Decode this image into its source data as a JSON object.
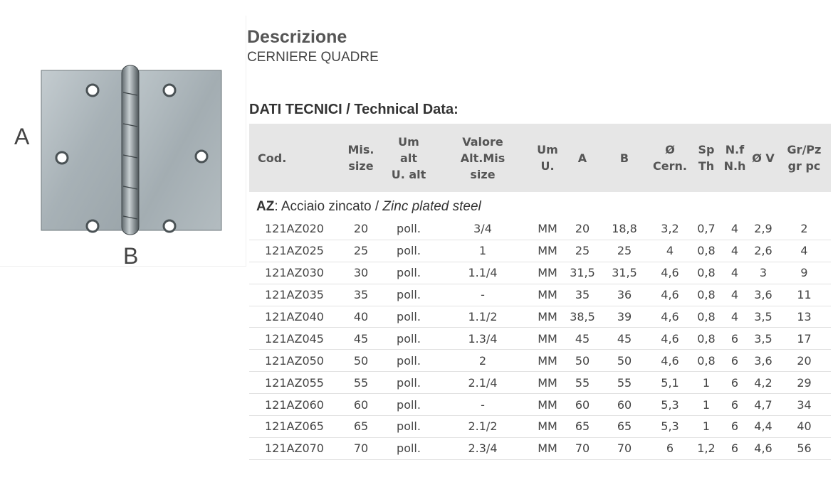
{
  "figure": {
    "label_a": "A",
    "label_b": "B"
  },
  "description": {
    "title": "Descrizione",
    "text": "CERNIERE QUADRE"
  },
  "technical": {
    "title": "DATI TECNICI / Technical Data:"
  },
  "table": {
    "headers": [
      [
        "Cod."
      ],
      [
        "Mis.",
        "size"
      ],
      [
        "Um",
        "alt",
        "U. alt"
      ],
      [
        "Valore",
        "Alt.Mis",
        "size"
      ],
      [
        "Um",
        "U."
      ],
      [
        "A"
      ],
      [
        "B"
      ],
      [
        "Ø",
        "Cern."
      ],
      [
        "Sp",
        "Th"
      ],
      [
        "N.f",
        "N.h"
      ],
      [
        "Ø V"
      ],
      [
        "Gr/Pz",
        "gr pc"
      ]
    ],
    "group": {
      "code": "AZ",
      "separator": ":",
      "name_it": "Acciaio zincato /",
      "name_en": "Zinc plated steel"
    },
    "rows": [
      [
        "121AZ020",
        "20",
        "poll.",
        "3/4",
        "MM",
        "20",
        "18,8",
        "3,2",
        "0,7",
        "4",
        "2,9",
        "2"
      ],
      [
        "121AZ025",
        "25",
        "poll.",
        "1",
        "MM",
        "25",
        "25",
        "4",
        "0,8",
        "4",
        "2,6",
        "4"
      ],
      [
        "121AZ030",
        "30",
        "poll.",
        "1.1/4",
        "MM",
        "31,5",
        "31,5",
        "4,6",
        "0,8",
        "4",
        "3",
        "9"
      ],
      [
        "121AZ035",
        "35",
        "poll.",
        "-",
        "MM",
        "35",
        "36",
        "4,6",
        "0,8",
        "4",
        "3,6",
        "11"
      ],
      [
        "121AZ040",
        "40",
        "poll.",
        "1.1/2",
        "MM",
        "38,5",
        "39",
        "4,6",
        "0,8",
        "4",
        "3,5",
        "13"
      ],
      [
        "121AZ045",
        "45",
        "poll.",
        "1.3/4",
        "MM",
        "45",
        "45",
        "4,6",
        "0,8",
        "6",
        "3,5",
        "17"
      ],
      [
        "121AZ050",
        "50",
        "poll.",
        "2",
        "MM",
        "50",
        "50",
        "4,6",
        "0,8",
        "6",
        "3,6",
        "20"
      ],
      [
        "121AZ055",
        "55",
        "poll.",
        "2.1/4",
        "MM",
        "55",
        "55",
        "5,1",
        "1",
        "6",
        "4,2",
        "29"
      ],
      [
        "121AZ060",
        "60",
        "poll.",
        "-",
        "MM",
        "60",
        "60",
        "5,3",
        "1",
        "6",
        "4,7",
        "34"
      ],
      [
        "121AZ065",
        "65",
        "poll.",
        "2.1/2",
        "MM",
        "65",
        "65",
        "5,3",
        "1",
        "6",
        "4,4",
        "40"
      ],
      [
        "121AZ070",
        "70",
        "poll.",
        "2.3/4",
        "MM",
        "70",
        "70",
        "6",
        "1,2",
        "6",
        "4,6",
        "56"
      ]
    ]
  },
  "colors": {
    "header_background": "#e6e6e6",
    "row_divider": "#e2e2e2",
    "text": "#444444",
    "hinge_metal": "#a9b3b8"
  }
}
